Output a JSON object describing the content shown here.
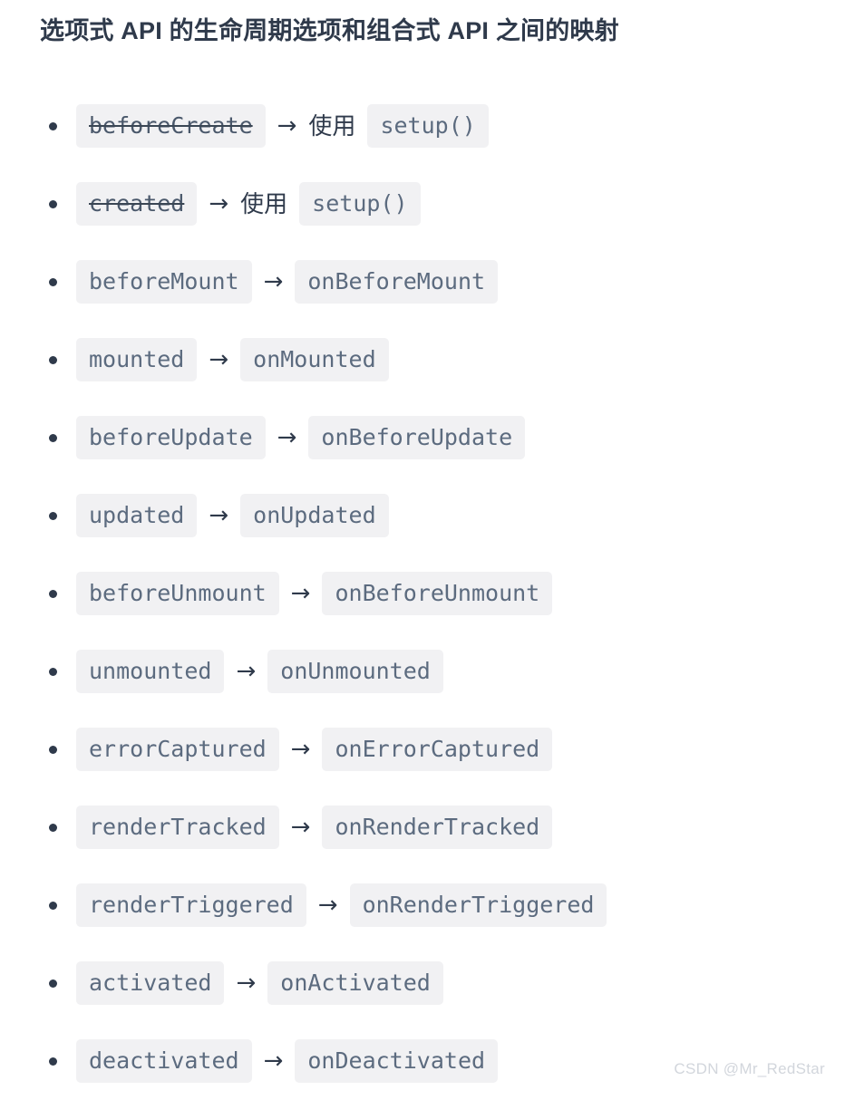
{
  "document": {
    "title": "选项式 API 的生命周期选项和组合式 API 之间的映射",
    "colors": {
      "background": "#ffffff",
      "title_text": "#2f3a4b",
      "chip_background": "#f1f1f3",
      "chip_text": "#5c6b7f",
      "arrow": "#2f3a4b",
      "bullet": "#2f3a4b",
      "watermark": "#d2d6dc"
    },
    "arrow_glyph": "→",
    "bullet_glyph": "•"
  },
  "list": {
    "items": [
      {
        "option": "beforeCreate",
        "option_struck": true,
        "note": "使用",
        "composition": "setup()"
      },
      {
        "option": "created",
        "option_struck": true,
        "note": "使用",
        "composition": "setup()"
      },
      {
        "option": "beforeMount",
        "option_struck": false,
        "note": "",
        "composition": "onBeforeMount"
      },
      {
        "option": "mounted",
        "option_struck": false,
        "note": "",
        "composition": "onMounted"
      },
      {
        "option": "beforeUpdate",
        "option_struck": false,
        "note": "",
        "composition": "onBeforeUpdate"
      },
      {
        "option": "updated",
        "option_struck": false,
        "note": "",
        "composition": "onUpdated"
      },
      {
        "option": "beforeUnmount",
        "option_struck": false,
        "note": "",
        "composition": "onBeforeUnmount"
      },
      {
        "option": "unmounted",
        "option_struck": false,
        "note": "",
        "composition": "onUnmounted"
      },
      {
        "option": "errorCaptured",
        "option_struck": false,
        "note": "",
        "composition": "onErrorCaptured"
      },
      {
        "option": "renderTracked",
        "option_struck": false,
        "note": "",
        "composition": "onRenderTracked"
      },
      {
        "option": "renderTriggered",
        "option_struck": false,
        "note": "",
        "composition": "onRenderTriggered"
      },
      {
        "option": "activated",
        "option_struck": false,
        "note": "",
        "composition": "onActivated"
      },
      {
        "option": "deactivated",
        "option_struck": false,
        "note": "",
        "composition": "onDeactivated"
      }
    ]
  },
  "watermark": {
    "text": "CSDN @Mr_RedStar"
  }
}
